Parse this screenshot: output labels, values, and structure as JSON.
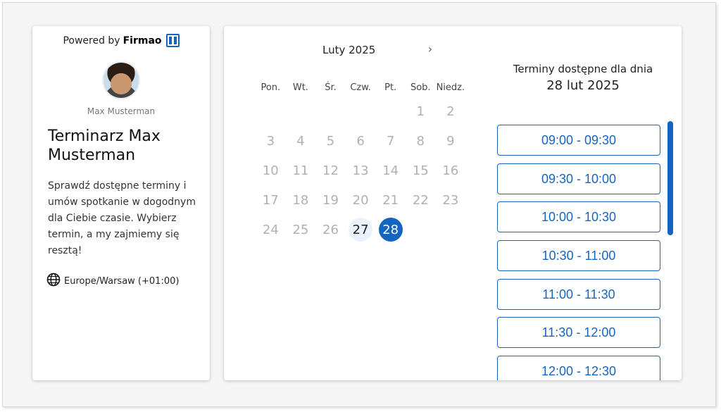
{
  "profile": {
    "powered_by": "Powered by",
    "brand": "Firmao",
    "owner_name": "Max Musterman",
    "title": "Terminarz Max Musterman",
    "description": "Sprawdź dostępne terminy i umów spotkanie w dogodnym dla Ciebie czasie. Wybierz termin, a my zajmiemy się resztą!",
    "timezone": "Europe/Warsaw (+01:00)"
  },
  "calendar": {
    "month_label": "Luty 2025",
    "next_icon": "›",
    "weekdays": [
      "Pon.",
      "Wt.",
      "Śr.",
      "Czw.",
      "Pt.",
      "Sob.",
      "Niedz."
    ],
    "days": [
      "",
      "",
      "",
      "",
      "",
      "1",
      "2",
      "3",
      "4",
      "5",
      "6",
      "7",
      "8",
      "9",
      "10",
      "11",
      "12",
      "13",
      "14",
      "15",
      "16",
      "17",
      "18",
      "19",
      "20",
      "21",
      "22",
      "23",
      "24",
      "25",
      "26",
      "27",
      "28",
      "",
      ""
    ],
    "available_day": "27",
    "selected_day": "28"
  },
  "slots": {
    "heading": "Terminy dostępne dla dnia",
    "date": "28 lut 2025",
    "times": [
      "09:00 - 09:30",
      "09:30 - 10:00",
      "10:00 - 10:30",
      "10:30 - 11:00",
      "11:00 - 11:30",
      "11:30 - 12:00",
      "12:00 - 12:30"
    ]
  },
  "colors": {
    "accent": "#1565c0",
    "available_bg": "#eaf2fb"
  }
}
